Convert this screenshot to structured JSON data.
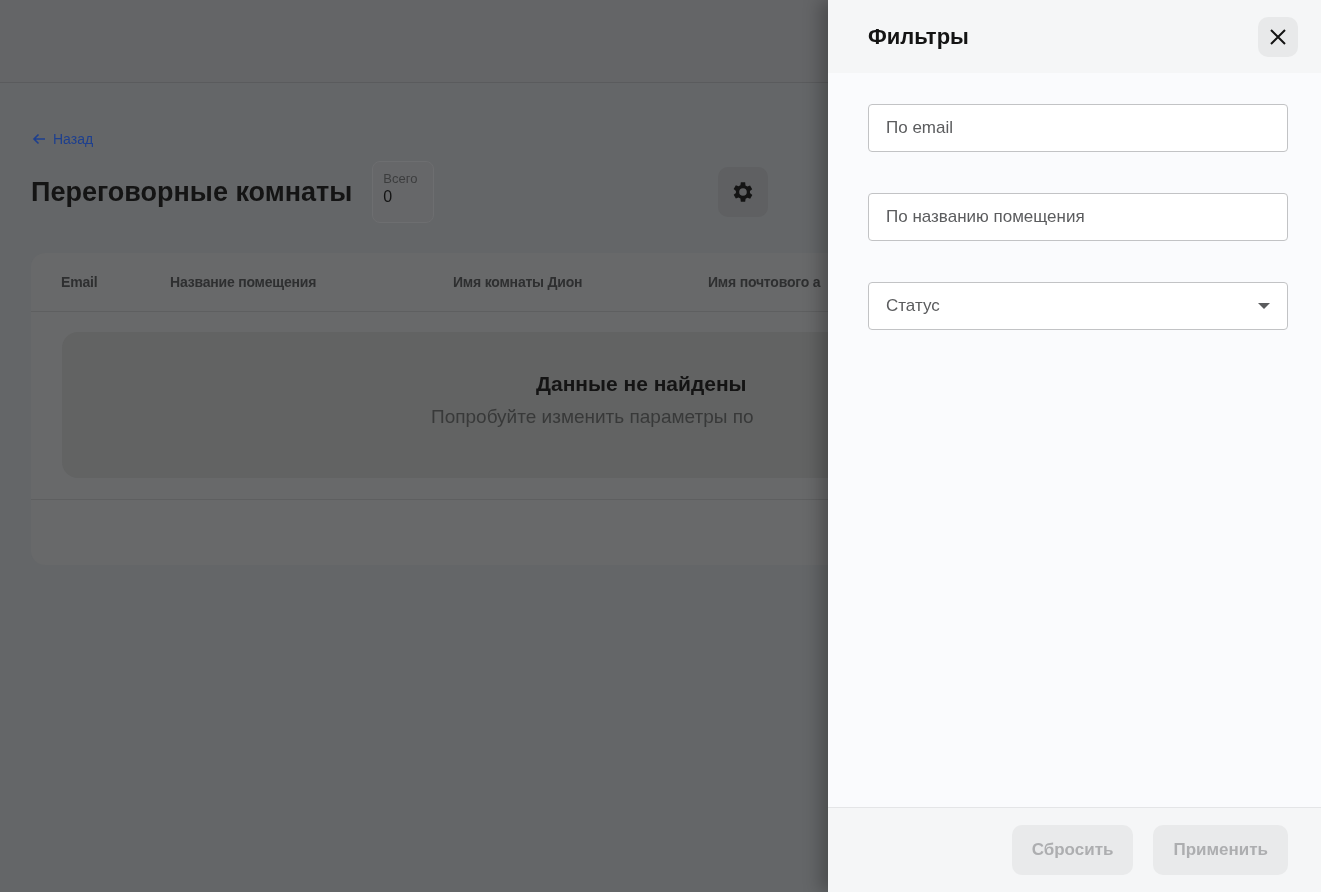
{
  "page": {
    "back_link": "Назад",
    "title": "Переговорные комнаты",
    "total": {
      "label": "Всего",
      "value": "0"
    },
    "table": {
      "columns": [
        "Email",
        "Название помещения",
        "Имя комнаты Дион",
        "Имя почтового а"
      ],
      "empty": {
        "title": "Данные не найдены",
        "message": "Попробуйте изменить параметры по"
      }
    }
  },
  "drawer": {
    "title": "Фильтры",
    "fields": [
      {
        "kind": "text",
        "placeholder": "По email"
      },
      {
        "kind": "text",
        "placeholder": "По названию помещения"
      },
      {
        "kind": "select",
        "placeholder": "Статус"
      }
    ],
    "buttons": [
      {
        "label": "Сбросить",
        "disabled": true
      },
      {
        "label": "Применить",
        "disabled": true
      }
    ]
  }
}
